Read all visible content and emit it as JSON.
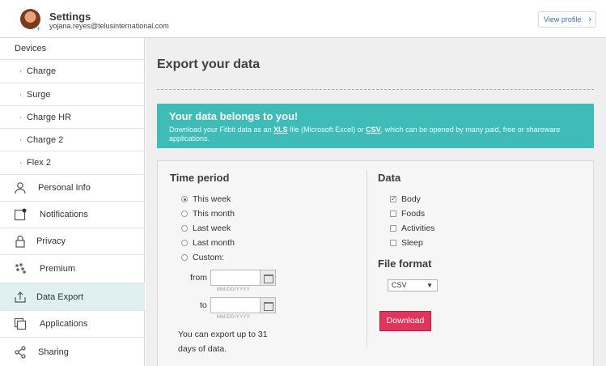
{
  "header": {
    "title": "Settings",
    "email": "yojana.reyes@telusinternational.com",
    "view_profile": "View profile"
  },
  "sidebar": {
    "devices_label": "Devices",
    "devices": [
      "Charge",
      "Surge",
      "Charge HR",
      "Charge 2",
      "Flex 2"
    ],
    "items": [
      {
        "label": "Personal Info",
        "icon": "person-icon"
      },
      {
        "label": "Notifications",
        "icon": "notification-icon"
      },
      {
        "label": "Privacy",
        "icon": "lock-icon"
      },
      {
        "label": "Premium",
        "icon": "premium-icon"
      },
      {
        "label": "Data Export",
        "icon": "export-icon"
      },
      {
        "label": "Applications",
        "icon": "applications-icon"
      },
      {
        "label": "Sharing",
        "icon": "share-icon"
      }
    ],
    "active_item": "Data Export"
  },
  "main": {
    "title": "Export your data",
    "banner": {
      "title": "Your data belongs to you!",
      "text_pre": "Download your Fitbit data as an ",
      "xls": "XLS",
      "text_mid": " file (Microsoft Excel) or ",
      "csv": "CSV",
      "text_post": ", which can be opened by many paid, free or shareware applications."
    },
    "time_period": {
      "title": "Time period",
      "options": [
        "This week",
        "This month",
        "Last week",
        "Last month",
        "Custom:"
      ],
      "selected": "This week",
      "from_label": "from",
      "to_label": "to",
      "date_hint": "MM/DD/YYYY",
      "from_value": "",
      "to_value": "",
      "note": "You can export up to 31 days of data."
    },
    "data": {
      "title": "Data",
      "options": [
        "Body",
        "Foods",
        "Activities",
        "Sleep"
      ],
      "checked": [
        "Body"
      ]
    },
    "file_format": {
      "title": "File format",
      "selected": "CSV",
      "button": "Download"
    }
  },
  "colors": {
    "banner": "#3fbcb7",
    "download": "#e2355c",
    "active_sidebar": "#dff0f1",
    "link": "#3d6fb6"
  }
}
